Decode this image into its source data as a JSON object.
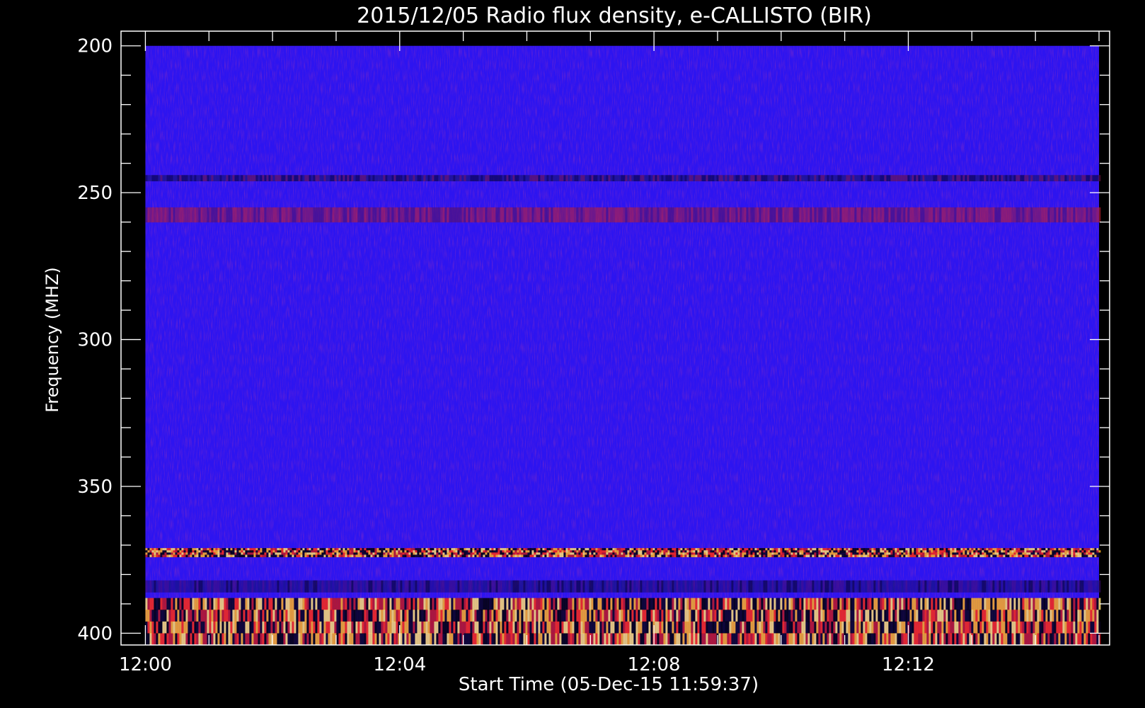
{
  "chart_data": {
    "type": "heatmap",
    "title": "2015/12/05  Radio flux density, e-CALLISTO (BIR)",
    "xlabel": "Start Time (05-Dec-15 11:59:37)",
    "ylabel": "Frequency (MHZ)",
    "x_axis": {
      "unit": "time (HH:MM)",
      "range": [
        "11:59:37",
        "12:15:10"
      ],
      "data_range": [
        "12:00",
        "12:15"
      ],
      "major_ticks": [
        "12:00",
        "12:04",
        "12:08",
        "12:12"
      ],
      "minor_tick_interval_minutes": 1
    },
    "y_axis": {
      "unit": "MHz",
      "range": [
        195,
        404
      ],
      "inverted": true,
      "data_range": [
        200,
        404
      ],
      "major_ticks": [
        200,
        250,
        300,
        350,
        400
      ],
      "minor_tick_interval": 10
    },
    "colormap": "blue-red-yellow",
    "colors": {
      "background": "#000000",
      "base": "#2d14f0",
      "mid": "#b81a3e",
      "high": "#ffd040"
    },
    "bands": [
      {
        "freq_range": [
          244,
          246
        ],
        "intensity": "low-mid",
        "note": "dark narrow stripe"
      },
      {
        "freq_range": [
          255,
          260
        ],
        "intensity": "mid",
        "note": "reddish band, stronger 12:00-12:03"
      },
      {
        "freq_range": [
          371,
          374
        ],
        "intensity": "high",
        "note": "bright patches near 12:05, 12:08, 12:13"
      },
      {
        "freq_range": [
          382,
          386
        ],
        "intensity": "low",
        "note": "dark striped band"
      },
      {
        "freq_range": [
          388,
          404
        ],
        "intensity": "high",
        "note": "strong emission with hot spots near 12:01, 12:05, 12:08"
      }
    ]
  }
}
